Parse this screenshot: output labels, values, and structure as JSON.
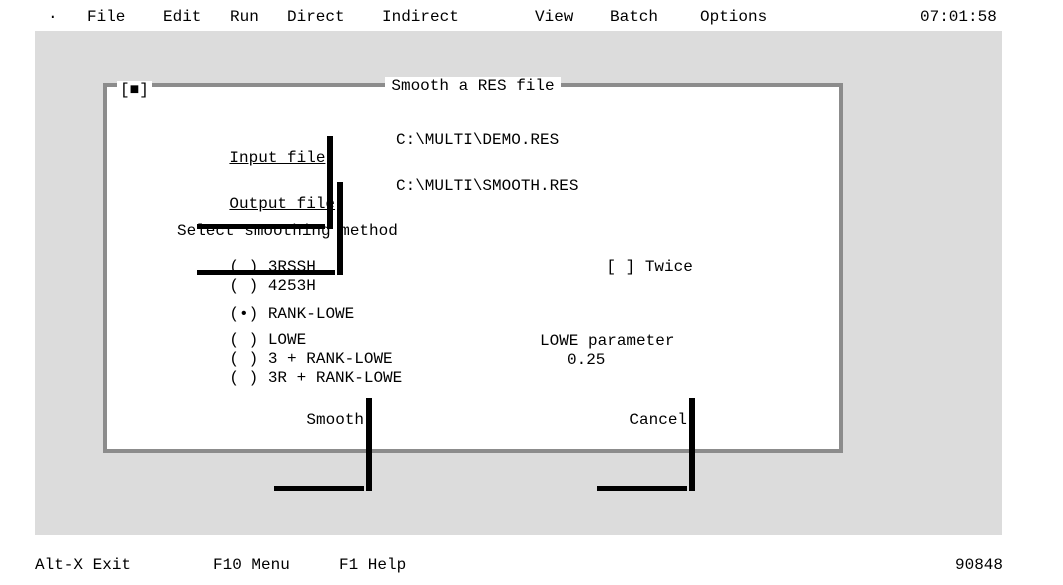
{
  "menubar": {
    "system_menu": "·",
    "items": [
      "File",
      "Edit",
      "Run",
      "Direct",
      "Indirect",
      "View",
      "Batch",
      "Options"
    ],
    "clock": "07:01:58"
  },
  "dialog": {
    "close_box": "[■]",
    "title": "Smooth a RES file",
    "input_file": {
      "button_label": "Input file",
      "value": "C:\\MULTI\\DEMO.RES"
    },
    "output_file": {
      "button_label": "Output file",
      "value": "C:\\MULTI\\SMOOTH.RES"
    },
    "method_group_label": "Select smoothing method",
    "methods": [
      {
        "marker": "( )",
        "label": "3RSSH",
        "selected": false
      },
      {
        "marker": "( )",
        "label": "4253H",
        "selected": false
      },
      {
        "marker": "(•)",
        "label": "RANK-LOWE",
        "selected": true
      },
      {
        "marker": "( )",
        "label": "LOWE",
        "selected": false
      },
      {
        "marker": "( )",
        "label": "3 + RANK-LOWE",
        "selected": false
      },
      {
        "marker": "( )",
        "label": "3R + RANK-LOWE",
        "selected": false
      }
    ],
    "twice": {
      "marker": "[ ]",
      "label": "Twice",
      "checked": false
    },
    "lowe_parameter": {
      "label": "LOWE parameter",
      "value": "0.25"
    },
    "smooth_button": "Smooth",
    "cancel_button": "Cancel"
  },
  "statusbar": {
    "items": [
      "Alt-X Exit",
      "F10 Menu",
      "F1 Help"
    ],
    "memory": "90848"
  },
  "colors": {
    "desktop": "#dcdcdc",
    "dialog_frame": "#8c8c8c",
    "background": "#ffffff",
    "text": "#000000"
  }
}
